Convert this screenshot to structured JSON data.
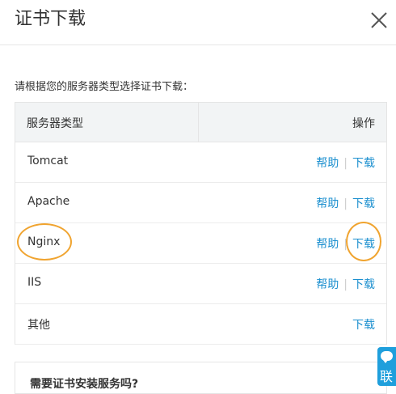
{
  "dialog": {
    "title": "证书下载",
    "close_icon": "close-icon"
  },
  "prompt": "请根据您的服务器类型选择证书下载：",
  "table": {
    "headers": {
      "server_type": "服务器类型",
      "actions": "操作"
    },
    "rows": [
      {
        "name": "Tomcat",
        "help": "帮助",
        "download": "下载"
      },
      {
        "name": "Apache",
        "help": "帮助",
        "download": "下载"
      },
      {
        "name": "Nginx",
        "help": "帮助",
        "download": "下载"
      },
      {
        "name": "IIS",
        "help": "帮助",
        "download": "下载"
      },
      {
        "name": "其他",
        "download": "下载"
      }
    ],
    "separator": "|"
  },
  "help_box": {
    "title": "需要证书安装服务吗?"
  },
  "side_contact": {
    "label": "联"
  },
  "colors": {
    "link": "#1b8fcf",
    "annotation": "#f0a430",
    "side_tab": "#1f9fdc"
  }
}
